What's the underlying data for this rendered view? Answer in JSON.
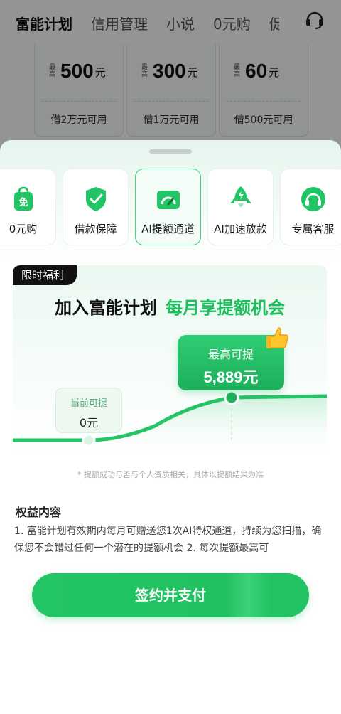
{
  "top_tabs": [
    "富能计划",
    "信用管理",
    "小说",
    "0元购",
    "促"
  ],
  "loan_cards": [
    {
      "tag": "最高",
      "amount": "500",
      "unit": "元",
      "note": "借2万元可用"
    },
    {
      "tag": "最高",
      "amount": "300",
      "unit": "元",
      "note": "借1万元可用"
    },
    {
      "tag": "最高",
      "amount": "60",
      "unit": "元",
      "note": "借500元可用"
    }
  ],
  "features": [
    {
      "label": "0元购",
      "icon": "free-bag-icon"
    },
    {
      "label": "借款保障",
      "icon": "shield-check-icon"
    },
    {
      "label": "AI提额通道",
      "icon": "gauge-card-icon"
    },
    {
      "label": "AI加速放款",
      "icon": "rocket-icon"
    },
    {
      "label": "专属客服",
      "icon": "headset-icon"
    }
  ],
  "promo": {
    "badge": "限时福利",
    "title_main": "加入富能计划",
    "title_highlight": "每月享提额机会",
    "current_label": "当前可提",
    "current_value": "0元",
    "max_label": "最高可提",
    "max_value": "5,889元"
  },
  "disclaimer": "* 提额成功与否与个人资质相关，具体以提额结果为准",
  "rights": {
    "title": "权益内容",
    "text": "1. 富能计划有效期内每月可赠送您1次AI特权通道，持续为您扫描，确保您不会错过任何一个潜在的提额机会 2. 每次提额最高可"
  },
  "pay_button": "签约并支付",
  "colors": {
    "accent": "#1fc160",
    "accent_text": "#1bbf5c",
    "badge_bg": "#111111"
  }
}
